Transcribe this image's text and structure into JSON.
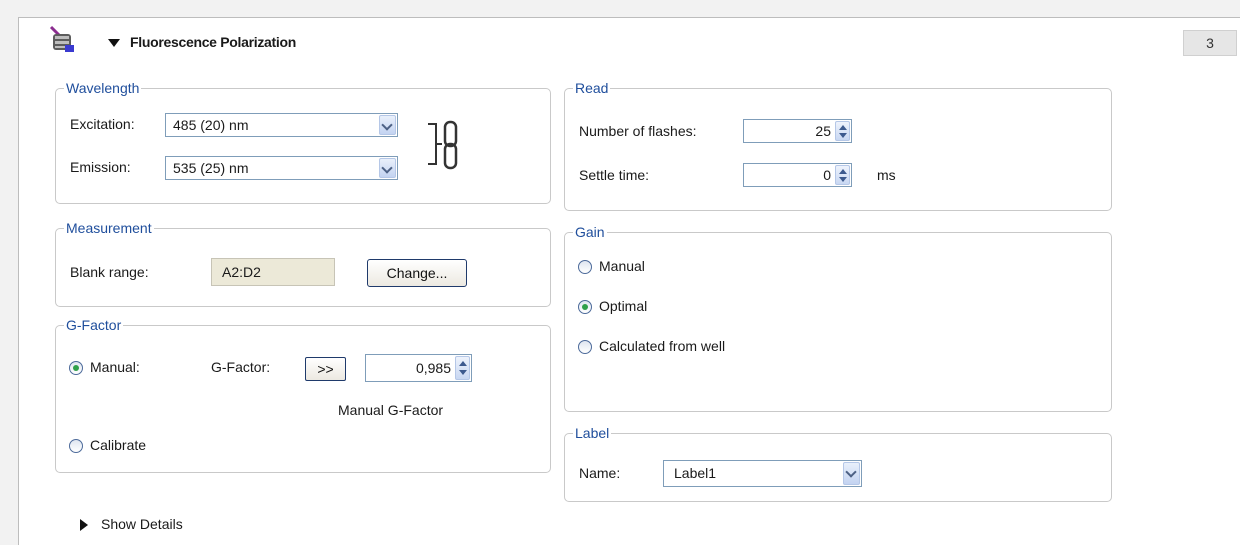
{
  "header": {
    "title": "Fluorescence Polarization",
    "step": "3",
    "icon": "plate-reader-icon",
    "expand_icon": "triangle-down-icon"
  },
  "wavelength": {
    "legend": "Wavelength",
    "excitation_label": "Excitation:",
    "excitation_value": "485 (20) nm",
    "emission_label": "Emission:",
    "emission_value": "535 (25) nm",
    "link_icon": "chain-link-icon"
  },
  "read": {
    "legend": "Read",
    "flashes_label": "Number of flashes:",
    "flashes_value": "25",
    "settle_label": "Settle time:",
    "settle_value": "0",
    "settle_unit": "ms"
  },
  "measurement": {
    "legend": "Measurement",
    "blank_label": "Blank range:",
    "blank_value": "A2:D2",
    "change_button": "Change..."
  },
  "gain": {
    "legend": "Gain",
    "options": [
      "Manual",
      "Optimal",
      "Calculated from well"
    ],
    "selected": "Optimal"
  },
  "gfactor": {
    "legend": "G-Factor",
    "manual_label": "Manual:",
    "gfactor_label": "G-Factor:",
    "transfer_button": ">>",
    "value": "0,985",
    "caption": "Manual G-Factor",
    "calibrate_label": "Calibrate",
    "selected": "Manual"
  },
  "label": {
    "legend": "Label",
    "name_label": "Name:",
    "name_value": "Label1"
  },
  "footer": {
    "show_details": "Show Details"
  },
  "colors": {
    "legend_blue": "#1f4e9c",
    "radio_green": "#2fa04a",
    "border": "#7f9db9"
  }
}
